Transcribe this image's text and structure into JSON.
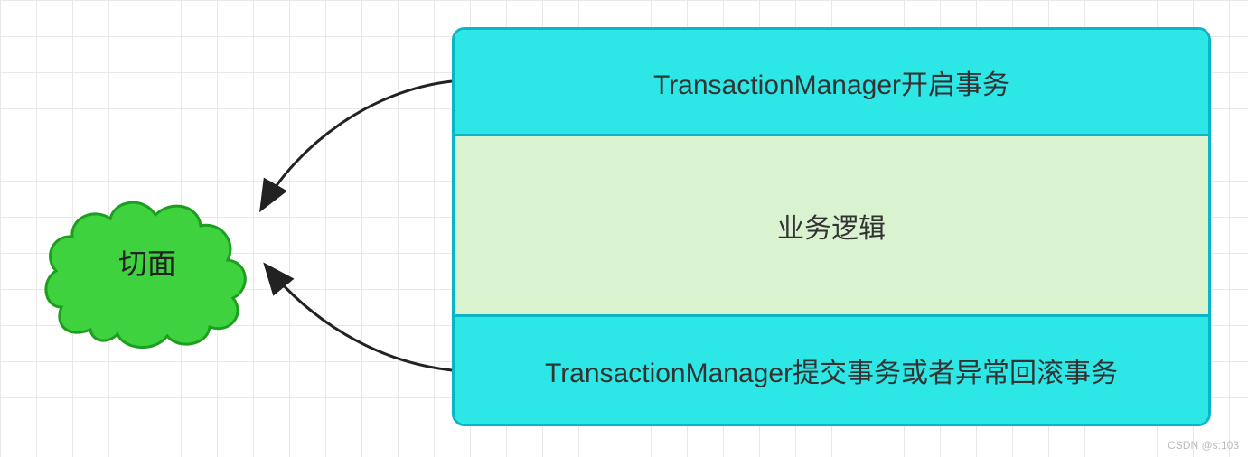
{
  "aspect": {
    "label": "切面"
  },
  "steps": {
    "top": "TransactionManager开启事务",
    "mid": "业务逻辑",
    "bot": "TransactionManager提交事务或者异常回滚事务"
  },
  "watermark": "CSDN @s:103"
}
